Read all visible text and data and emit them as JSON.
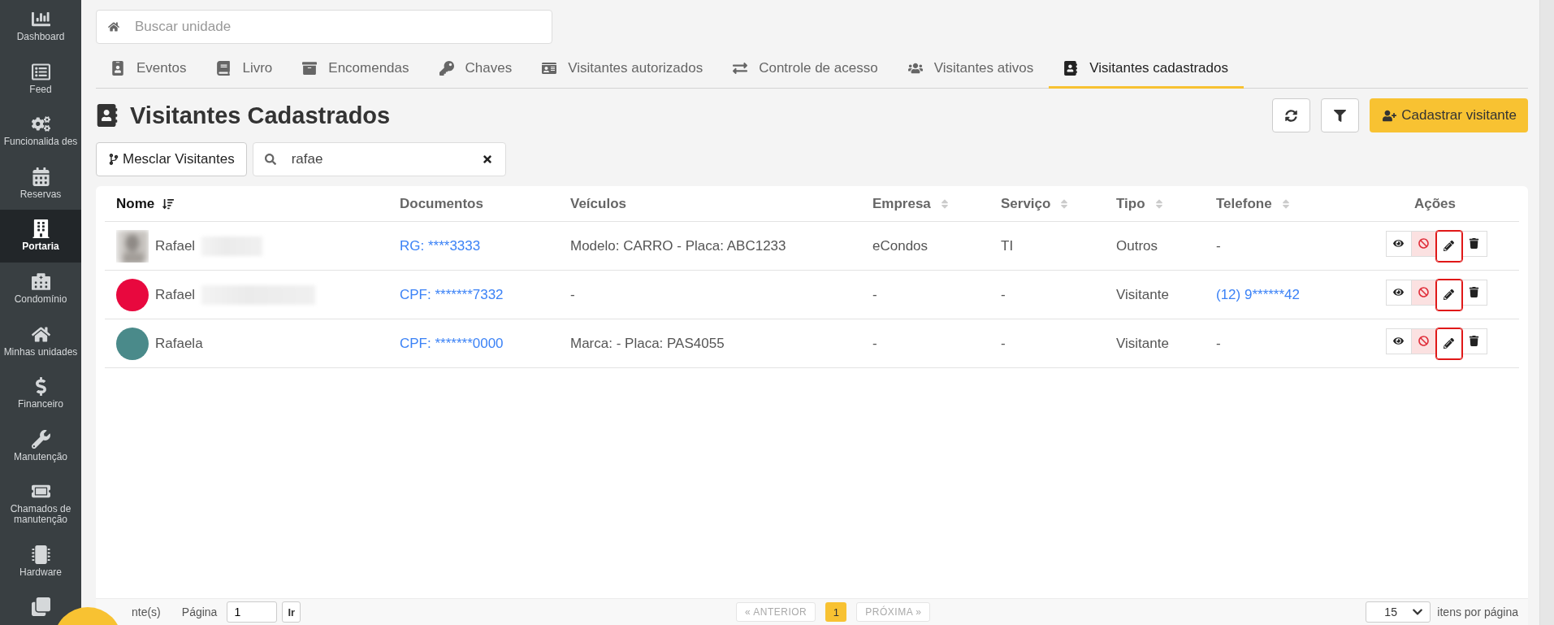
{
  "sidebar": {
    "items": [
      {
        "label": "Dashboard",
        "selected": false
      },
      {
        "label": "Feed",
        "selected": false
      },
      {
        "label": "Funcionalida des",
        "selected": false
      },
      {
        "label": "Reservas",
        "selected": false
      },
      {
        "label": "Portaria",
        "selected": true
      },
      {
        "label": "Condomínio",
        "selected": false
      },
      {
        "label": "Minhas unidades",
        "selected": false
      },
      {
        "label": "Financeiro",
        "selected": false
      },
      {
        "label": "Manutenção",
        "selected": false
      },
      {
        "label": "Chamados de manutenção",
        "selected": false
      },
      {
        "label": "Hardware",
        "selected": false
      }
    ]
  },
  "unit_search": {
    "placeholder": "Buscar unidade"
  },
  "tabs": [
    {
      "label": "Eventos",
      "selected": false
    },
    {
      "label": "Livro",
      "selected": false
    },
    {
      "label": "Encomendas",
      "selected": false
    },
    {
      "label": "Chaves",
      "selected": false
    },
    {
      "label": "Visitantes autorizados",
      "selected": false
    },
    {
      "label": "Controle de acesso",
      "selected": false
    },
    {
      "label": "Visitantes ativos",
      "selected": false
    },
    {
      "label": "Visitantes cadastrados",
      "selected": true
    }
  ],
  "page_title": "Visitantes Cadastrados",
  "register_button": "Cadastrar visitante",
  "merge_button": "Mesclar Visitantes",
  "visitor_search": {
    "value": "rafae"
  },
  "table": {
    "columns": [
      {
        "label": "Nome",
        "sorted": true
      },
      {
        "label": "Documentos"
      },
      {
        "label": "Veículos"
      },
      {
        "label": "Empresa",
        "sorted": false
      },
      {
        "label": "Serviço",
        "sorted": false
      },
      {
        "label": "Tipo",
        "sorted": false
      },
      {
        "label": "Telefone",
        "sorted": false
      },
      {
        "label": "Ações"
      }
    ],
    "rows": [
      {
        "name": "Rafael",
        "redacted": true,
        "document": "RG: ****3333",
        "vehicle": "Modelo: CARRO - Placa: ABC1233",
        "company": "eCondos",
        "service": "TI",
        "type": "Outros",
        "phone": "-",
        "phone_is_link": false,
        "edit_highlighted": true
      },
      {
        "avatar": {
          "kind": "color",
          "color": "#e8083e"
        },
        "name": "Rafael",
        "redacted": true,
        "document": "CPF: *******7332",
        "vehicle": "-",
        "company": "-",
        "service": "-",
        "type": "Visitante",
        "phone": "(12) 9******42",
        "phone_is_link": true,
        "edit_highlighted": true
      },
      {
        "avatar": {
          "kind": "color",
          "color": "#4a8a8a"
        },
        "name": "Rafaela",
        "redacted": false,
        "document": "CPF: *******0000",
        "vehicle": "Marca: - Placa: PAS4055",
        "company": "-",
        "service": "-",
        "type": "Visitante",
        "phone": "-",
        "phone_is_link": false,
        "edit_highlighted": true
      }
    ]
  },
  "footer": {
    "count": "nte(s)",
    "page_label": "Página",
    "page_value": "1",
    "go_button": "Ir",
    "prev": {
      "label": "« ANTERIOR",
      "disabled": true
    },
    "pages": [
      {
        "label": "1",
        "selected": true
      }
    ],
    "next": {
      "label": "PRÓXIMA »",
      "disabled": true
    },
    "per_page": "15",
    "per_page_label": "itens por página"
  }
}
